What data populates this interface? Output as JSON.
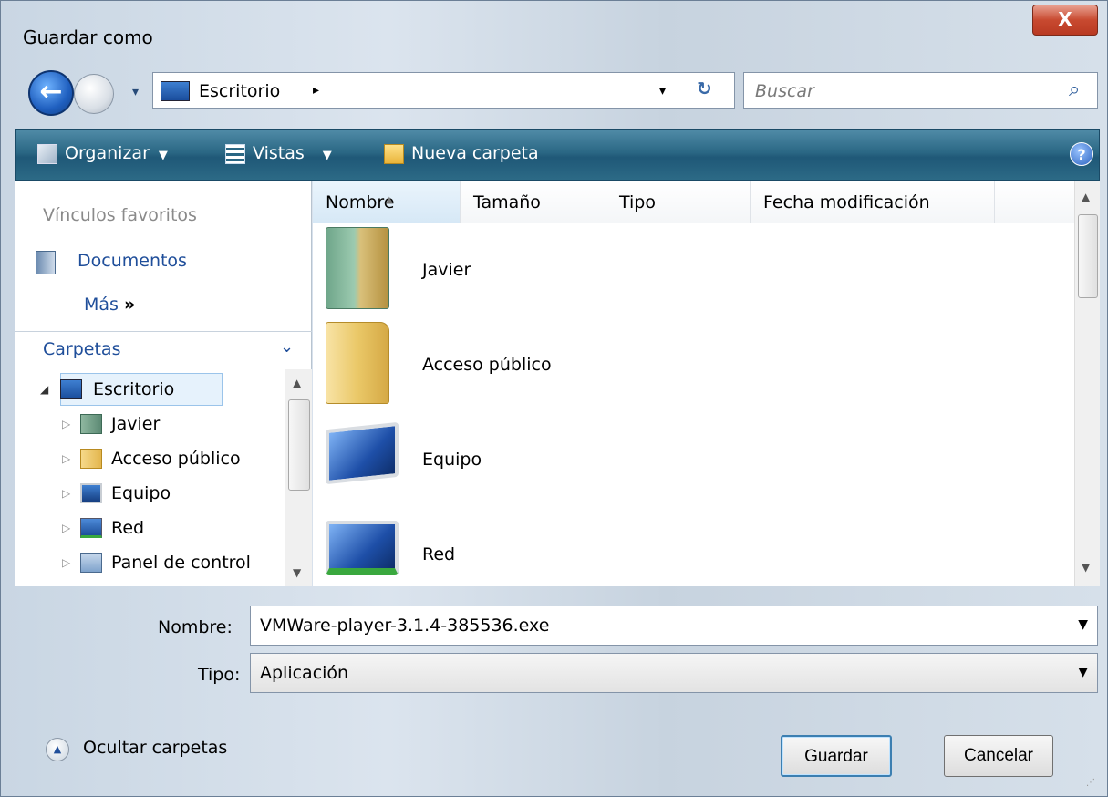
{
  "window": {
    "title": "Guardar como",
    "close_label": "X"
  },
  "nav": {
    "address_location": "Escritorio",
    "search_placeholder": "Buscar",
    "breadcrumb_arrow": "▸",
    "dropdown_arrow": "▾",
    "refresh_glyph": "⁴⁺"
  },
  "toolbar": {
    "organize_label": "Organizar",
    "views_label": "Vistas",
    "new_folder_label": "Nueva carpeta",
    "help_label": "?"
  },
  "left_pane": {
    "favorites_heading": "Vínculos favoritos",
    "favorite_documents": "Documentos",
    "more_label": "Más",
    "more_glyph": "»",
    "folders_heading": "Carpetas",
    "folders_chevron": "⌄",
    "tree": [
      {
        "label": "Escritorio",
        "icon": "desktop-icon",
        "expanded": true,
        "selected": true
      },
      {
        "label": "Javier",
        "icon": "user-folder-icon"
      },
      {
        "label": "Acceso público",
        "icon": "folder-icon"
      },
      {
        "label": "Equipo",
        "icon": "computer-icon"
      },
      {
        "label": "Red",
        "icon": "network-icon"
      },
      {
        "label": "Panel de control",
        "icon": "control-panel-icon"
      }
    ]
  },
  "file_list": {
    "columns": [
      "Nombre",
      "Tamaño",
      "Tipo",
      "Fecha modificación"
    ],
    "sorted_column": "Nombre",
    "items": [
      {
        "name": "Javier",
        "icon": "user-folder-icon"
      },
      {
        "name": "Acceso público",
        "icon": "folder-icon"
      },
      {
        "name": "Equipo",
        "icon": "computer-icon"
      },
      {
        "name": "Red",
        "icon": "network-icon"
      }
    ]
  },
  "form": {
    "filename_label": "Nombre:",
    "filename_value": "VMWare-player-3.1.4-385536.exe",
    "filetype_label": "Tipo:",
    "filetype_value": "Aplicación"
  },
  "footer": {
    "toggle_folders_label": "Ocultar carpetas",
    "save_label": "Guardar",
    "cancel_label": "Cancelar"
  },
  "colors": {
    "toolbar_bg": "#2a6784",
    "link": "#1f4e9a",
    "close_red": "#c84a30"
  }
}
